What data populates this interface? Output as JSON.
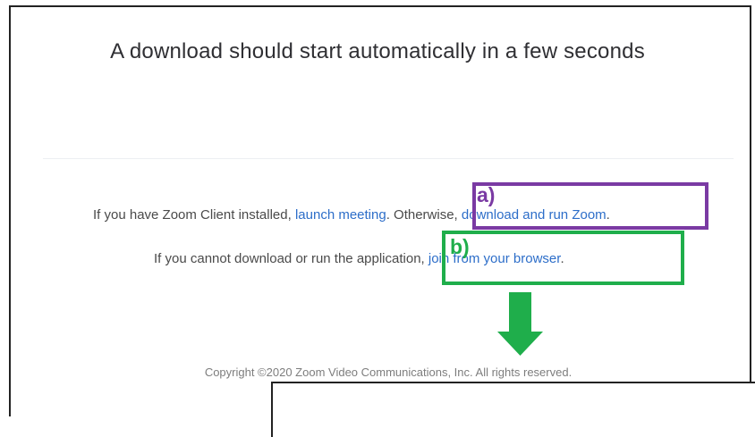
{
  "headline": "A download should start automatically in a few seconds",
  "line1": {
    "prefix": "If you have Zoom Client installed, ",
    "launch_link": "launch meeting",
    "middle": ". Otherwise, ",
    "download_link": "download and run Zoom",
    "suffix": "."
  },
  "line2": {
    "prefix": "If you cannot download or run the application, ",
    "browser_link": "join from your browser",
    "suffix": "."
  },
  "annotations": {
    "a": {
      "label": "a)",
      "color": "#7a3aa3"
    },
    "b": {
      "label": "b)",
      "color": "#1fae4b"
    },
    "arrow_color": "#1fae4b"
  },
  "footer": {
    "copyright": "Copyright ©2020 Zoom Video Communications, Inc. All rights reserved."
  }
}
